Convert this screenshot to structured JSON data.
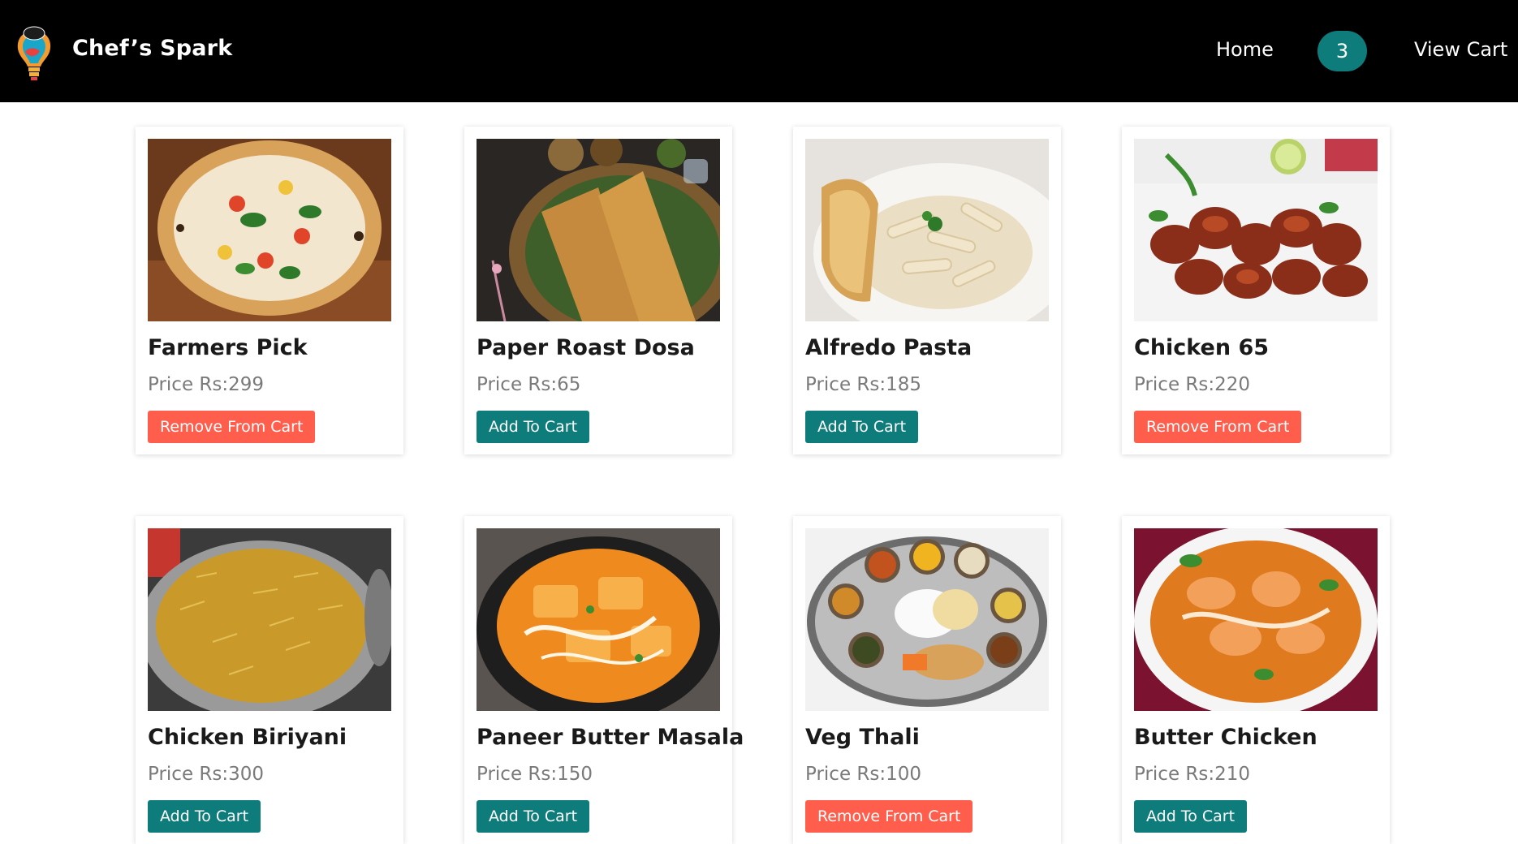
{
  "navbar": {
    "brand": "Chef’s Spark",
    "home_label": "Home",
    "cart_count": "3",
    "view_cart_label": "View Cart"
  },
  "colors": {
    "navbar_bg": "#000000",
    "accent_teal": "#0f7c7c",
    "remove_red": "#ff5e4d"
  },
  "products": [
    {
      "name": "Farmers Pick",
      "price": "Price Rs:299",
      "button": "Remove From Cart",
      "in_cart": true
    },
    {
      "name": "Paper Roast Dosa",
      "price": "Price Rs:65",
      "button": "Add To Cart",
      "in_cart": false
    },
    {
      "name": "Alfredo Pasta",
      "price": "Price Rs:185",
      "button": "Add To Cart",
      "in_cart": false
    },
    {
      "name": "Chicken 65",
      "price": "Price Rs:220",
      "button": "Remove From Cart",
      "in_cart": true
    },
    {
      "name": "Chicken Biriyani",
      "price": "Price Rs:300",
      "button": "Add To Cart",
      "in_cart": false
    },
    {
      "name": "Paneer Butter Masala",
      "price": "Price Rs:150",
      "button": "Add To Cart",
      "in_cart": false
    },
    {
      "name": "Veg Thali",
      "price": "Price Rs:100",
      "button": "Remove From Cart",
      "in_cart": true
    },
    {
      "name": "Butter Chicken",
      "price": "Price Rs:210",
      "button": "Add To Cart",
      "in_cart": false
    }
  ]
}
